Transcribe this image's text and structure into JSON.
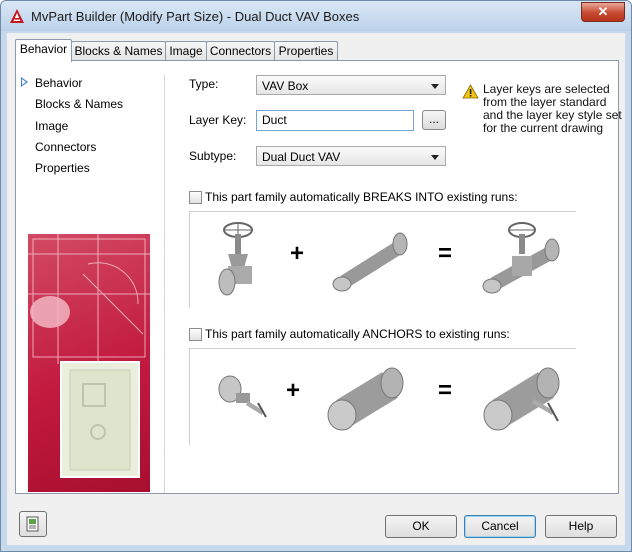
{
  "window": {
    "title": "MvPart Builder (Modify Part Size) - Dual Duct VAV Boxes",
    "close_label": "✕"
  },
  "tabs": [
    {
      "label": "Behavior",
      "active": true
    },
    {
      "label": "Blocks & Names",
      "active": false
    },
    {
      "label": "Image",
      "active": false
    },
    {
      "label": "Connectors",
      "active": false
    },
    {
      "label": "Properties",
      "active": false
    }
  ],
  "nav": {
    "items": [
      {
        "label": "Behavior",
        "selected": true
      },
      {
        "label": "Blocks & Names",
        "selected": false
      },
      {
        "label": "Image",
        "selected": false
      },
      {
        "label": "Connectors",
        "selected": false
      },
      {
        "label": "Properties",
        "selected": false
      }
    ]
  },
  "form": {
    "type_label": "Type:",
    "type_value": "VAV Box",
    "layer_key_label": "Layer Key:",
    "layer_key_value": "Duct",
    "browse_label": "...",
    "subtype_label": "Subtype:",
    "subtype_value": "Dual Duct VAV"
  },
  "note": {
    "text": "Layer keys are selected from the layer standard and the layer key style set for the current drawing"
  },
  "breaks": {
    "label": "This part family automatically BREAKS INTO existing runs:",
    "checked": false,
    "plus": "+",
    "equals": "="
  },
  "anchors": {
    "label": "This part family automatically ANCHORS to existing runs:",
    "checked": false,
    "plus": "+",
    "equals": "="
  },
  "buttons": {
    "ok": "OK",
    "cancel": "Cancel",
    "help": "Help"
  },
  "colors": {
    "accent": "#3a7fd0",
    "window_frame": "#c5d8ec",
    "close": "#c74a32",
    "picture": "#c21a3f",
    "warning": "#f2c40f"
  }
}
